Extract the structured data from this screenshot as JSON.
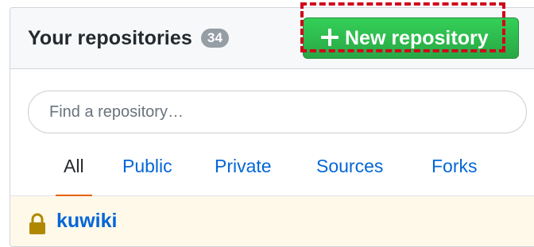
{
  "header": {
    "title": "Your repositories",
    "count": "34",
    "new_button_label": "New repository"
  },
  "search": {
    "placeholder": "Find a repository…",
    "value": ""
  },
  "tabs": [
    {
      "label": "All",
      "selected": true
    },
    {
      "label": "Public",
      "selected": false
    },
    {
      "label": "Private",
      "selected": false
    },
    {
      "label": "Sources",
      "selected": false
    },
    {
      "label": "Forks",
      "selected": false
    }
  ],
  "repos": [
    {
      "name": "kuwiki",
      "icon": "lock-icon"
    }
  ],
  "colors": {
    "accent_green": "#2ea44f",
    "link_blue": "#0366d6",
    "selected_tab_underline": "#e36209",
    "highlight_red": "#d0021b",
    "private_row_bg": "#fff9ea"
  }
}
